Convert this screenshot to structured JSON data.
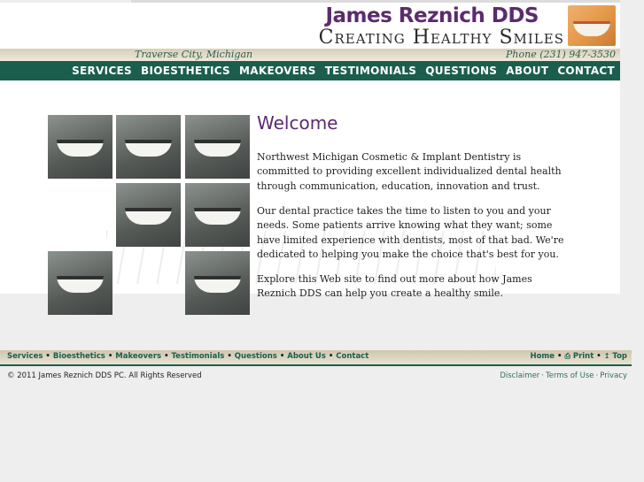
{
  "header": {
    "practice_name": "James Reznich DDS",
    "tagline": "Creating Healthy Smiles",
    "location": "Traverse City, Michigan",
    "phone": "Phone (231) 947-3530"
  },
  "nav": [
    "SERVICES",
    "BIOESTHETICS",
    "MAKEOVERS",
    "TESTIMONIALS",
    "QUESTIONS",
    "ABOUT",
    "CONTACT"
  ],
  "main": {
    "title": "Welcome",
    "paragraphs": [
      "Northwest Michigan Cosmetic & Implant Dentistry is committed to providing excellent individualized dental health through communication, education, innovation and trust.",
      "Our dental practice takes the time to listen to you and your needs. Some patients arrive knowing what they want; some have limited experience with dentists, most of that bad. We're dedicated to helping you make the choice that's best for you.",
      "Explore this Web site to find out more about how James Reznich DDS can help you create a healthy smile."
    ]
  },
  "footer": {
    "links": [
      "Services",
      "Bioesthetics",
      "Makeovers",
      "Testimonials",
      "Questions",
      "About Us",
      "Contact"
    ],
    "util_links": {
      "home": "Home",
      "print": "Print",
      "top": "Top"
    },
    "copyright": "© 2011 James Reznich DDS PC. All Rights Reserved",
    "legal": {
      "disclaimer": "Disclaimer",
      "terms": "Terms of Use",
      "privacy": "Privacy"
    }
  }
}
